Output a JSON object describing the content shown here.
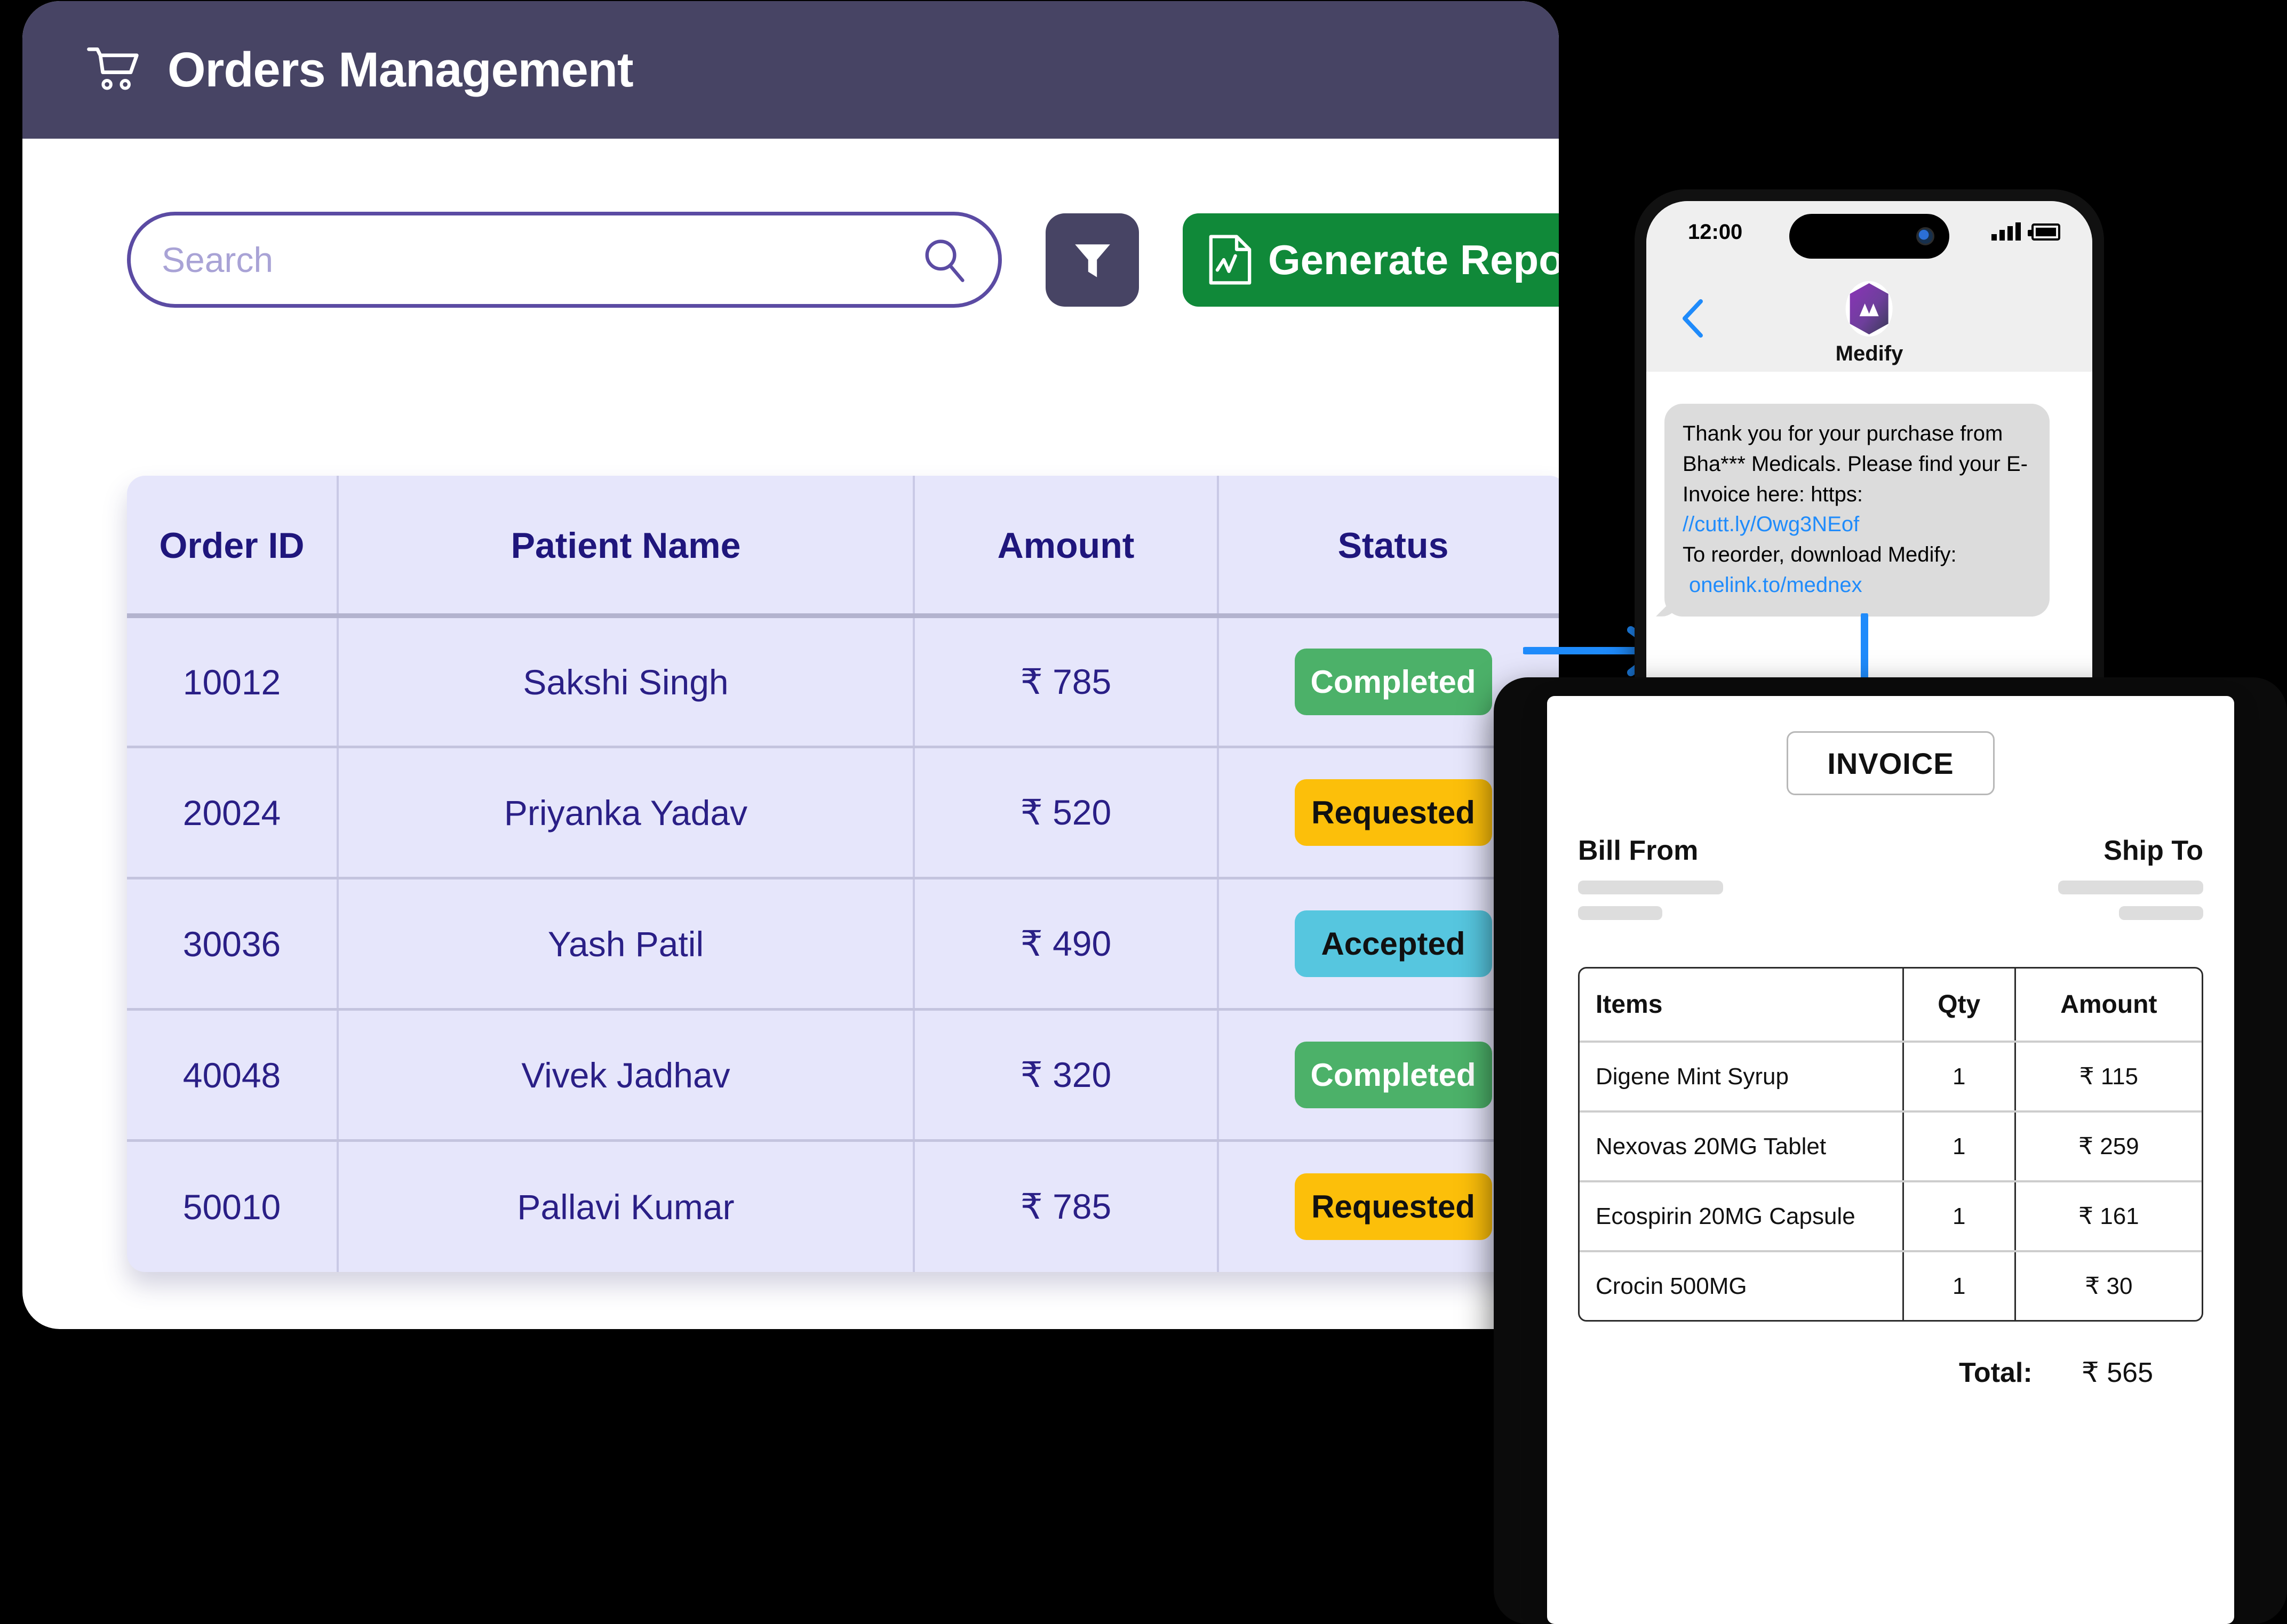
{
  "app": {
    "title": "Orders Management",
    "header_icon": "shopping-cart-icon",
    "header_bg": "#474464"
  },
  "toolbar": {
    "search_placeholder": "Search",
    "search_value": "",
    "search_icon": "search-icon",
    "filter_icon": "filter-funnel-icon",
    "generate_report_label": "Generate Report",
    "report_icon": "report-document-icon",
    "report_color": "#108939",
    "filter_color": "#474464"
  },
  "orders_table": {
    "columns": [
      "Order ID",
      "Patient Name",
      "Amount",
      "Status"
    ],
    "rows": [
      {
        "order_id": "10012",
        "patient_name": "Sakshi Singh",
        "amount": "₹ 785",
        "status": "Completed",
        "status_kind": "completed"
      },
      {
        "order_id": "20024",
        "patient_name": "Priyanka Yadav",
        "amount": "₹ 520",
        "status": "Requested",
        "status_kind": "requested"
      },
      {
        "order_id": "30036",
        "patient_name": "Yash Patil",
        "amount": "₹ 490",
        "status": "Accepted",
        "status_kind": "accepted"
      },
      {
        "order_id": "40048",
        "patient_name": "Vivek Jadhav",
        "amount": "₹ 320",
        "status": "Completed",
        "status_kind": "completed"
      },
      {
        "order_id": "50010",
        "patient_name": "Pallavi Kumar",
        "amount": "₹ 785",
        "status": "Requested",
        "status_kind": "requested"
      }
    ],
    "status_colors": {
      "completed": "#4cb169",
      "requested": "#fcbf0a",
      "accepted": "#56c6df"
    }
  },
  "phone": {
    "status_time": "12:00",
    "signal_icon": "signal-bars-icon",
    "battery_icon": "battery-icon",
    "back_icon": "back-chevron-icon",
    "app_logo_icon": "medify-logo-icon",
    "app_name": "Medify",
    "message": {
      "line1": "Thank you for your purchase from",
      "line2": "Bha*** Medicals. Please find your E-",
      "line3": "Invoice here: https:",
      "link1": "//cutt.ly/Owg3NEof",
      "line4": "To reorder, download Medify:",
      "link2": "onelink.to/mednex"
    }
  },
  "arrows": {
    "right_arrow_icon": "arrow-right-icon",
    "down_arrow_icon": "arrow-down-icon",
    "color": "#1f8bfb"
  },
  "invoice": {
    "badge_label": "INVOICE",
    "bill_from_label": "Bill From",
    "ship_to_label": "Ship To",
    "columns": [
      "Items",
      "Qty",
      "Amount"
    ],
    "items": [
      {
        "name": "Digene Mint Syrup",
        "qty": "1",
        "amount": "₹ 115"
      },
      {
        "name": "Nexovas 20MG Tablet",
        "qty": "1",
        "amount": "₹ 259"
      },
      {
        "name": "Ecospirin 20MG Capsule",
        "qty": "1",
        "amount": "₹ 161"
      },
      {
        "name": "Crocin 500MG",
        "qty": "1",
        "amount": "₹ 30"
      }
    ],
    "total_label": "Total:",
    "total_value": "₹ 565"
  }
}
